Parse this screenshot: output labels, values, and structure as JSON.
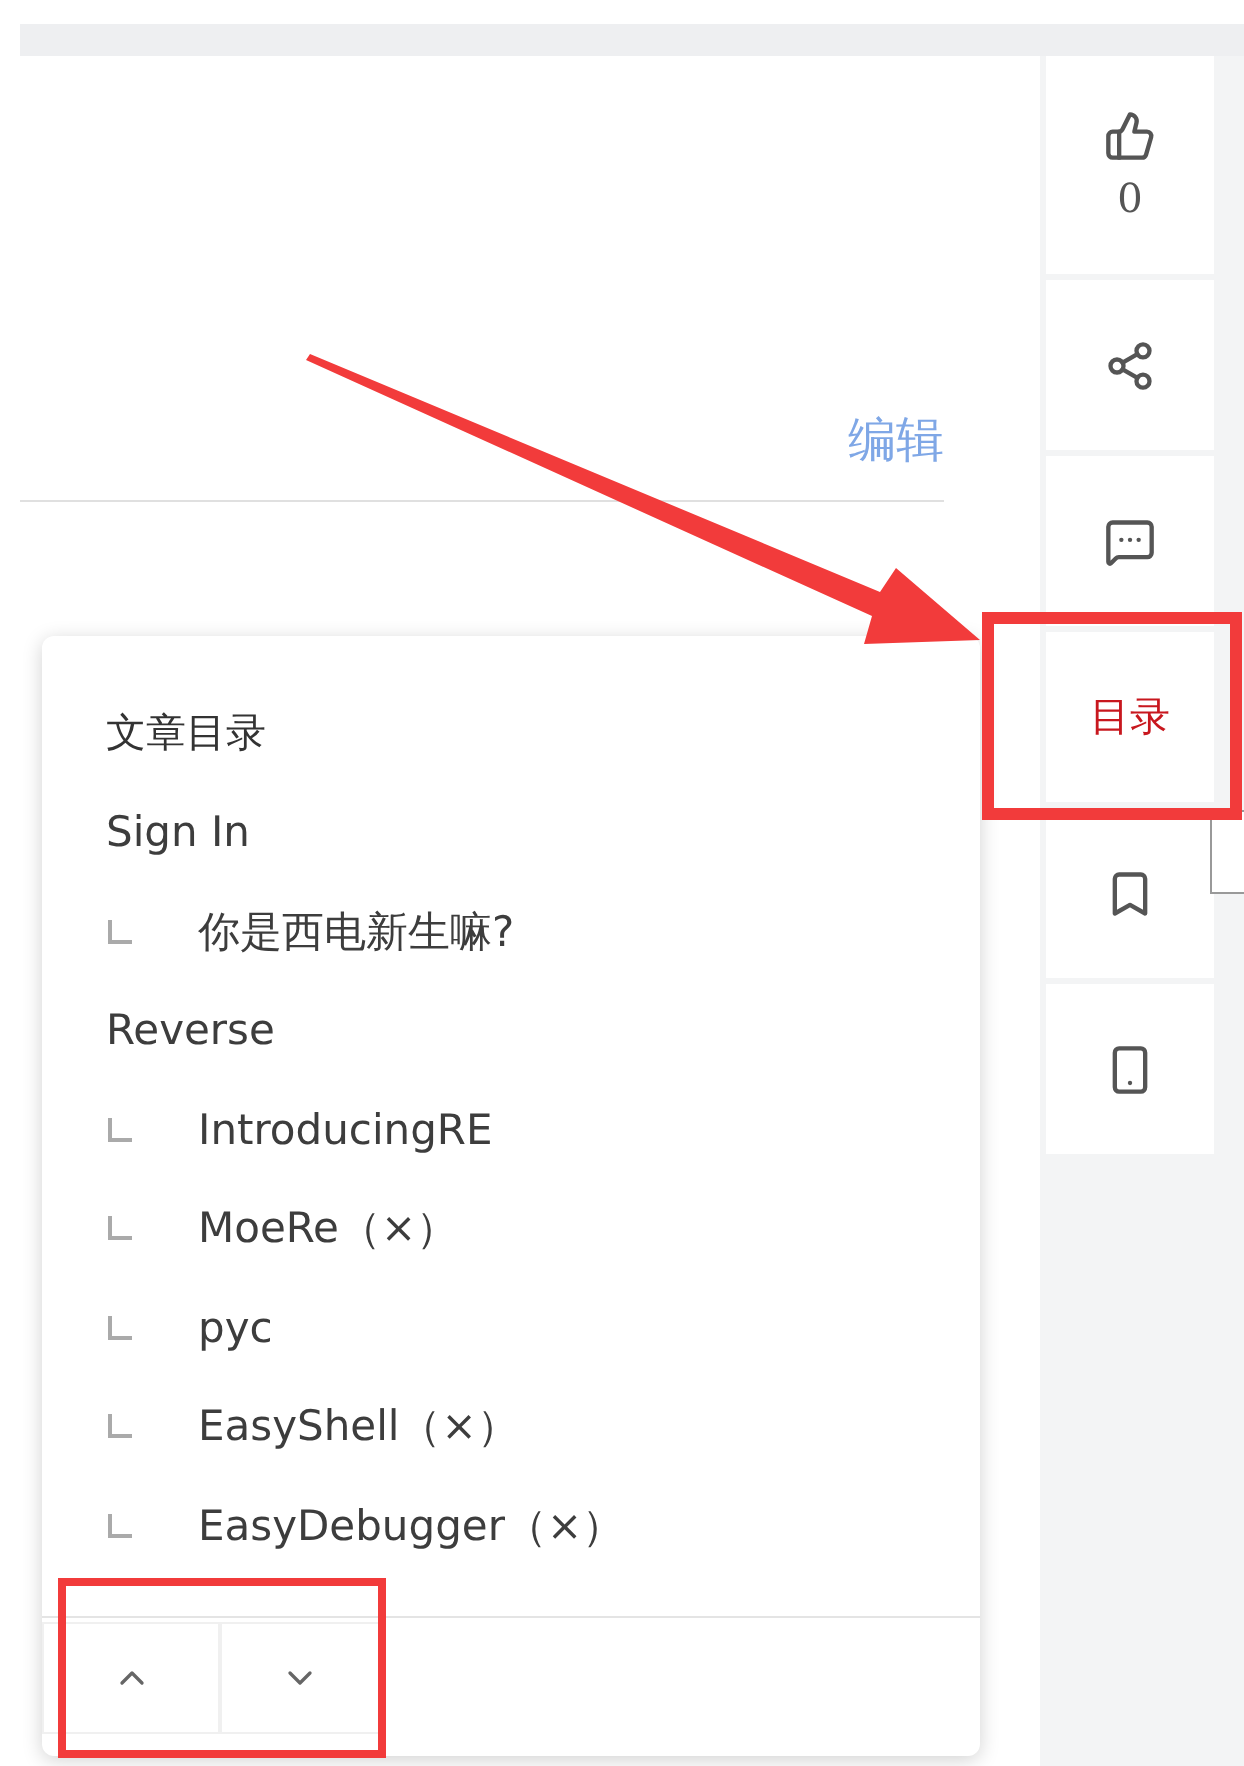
{
  "article": {
    "edit_link": "编辑"
  },
  "sidebar": {
    "items": [
      {
        "kind": "like",
        "count": "0",
        "selected": false
      },
      {
        "kind": "share",
        "selected": false
      },
      {
        "kind": "comment",
        "selected": false
      },
      {
        "kind": "toc",
        "label": "目录",
        "selected": true
      },
      {
        "kind": "bookmark",
        "selected": false
      },
      {
        "kind": "mobile",
        "selected": false
      }
    ]
  },
  "toc_panel": {
    "title": "文章目录",
    "sections": [
      {
        "label": "Sign In",
        "children": [
          {
            "label": "你是西电新生嘛?"
          }
        ]
      },
      {
        "label": "Reverse",
        "children": [
          {
            "label": "IntroducingRE"
          },
          {
            "label": "MoeRe（×）"
          },
          {
            "label": "pyc"
          },
          {
            "label": "EasyShell（×）"
          },
          {
            "label": "EasyDebugger（×）"
          }
        ]
      }
    ],
    "footer_buttons": [
      {
        "kind": "up"
      },
      {
        "kind": "down"
      }
    ]
  }
}
